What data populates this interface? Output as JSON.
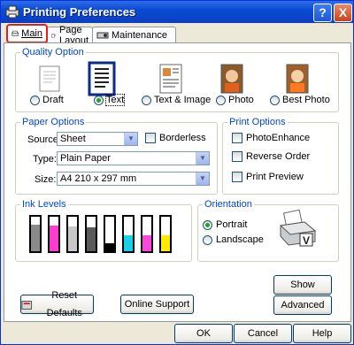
{
  "window": {
    "title": "Printing Preferences",
    "help_btn": "?",
    "close_btn": "X"
  },
  "tabs": [
    {
      "label": "Main",
      "active": true
    },
    {
      "label": "Page Layout",
      "active": false
    },
    {
      "label": "Maintenance",
      "active": false
    }
  ],
  "quality": {
    "legend": "Quality Option",
    "options": [
      {
        "label": "Draft",
        "icon": "draft-icon",
        "selected": false
      },
      {
        "label": "Text",
        "icon": "text-icon",
        "selected": true
      },
      {
        "label": "Text & Image",
        "icon": "text-image-icon",
        "selected": false
      },
      {
        "label": "Photo",
        "icon": "photo-icon",
        "selected": false
      },
      {
        "label": "Best Photo",
        "icon": "best-photo-icon",
        "selected": false
      }
    ]
  },
  "paper": {
    "legend": "Paper Options",
    "source_label": "Source:",
    "source_value": "Sheet",
    "borderless_label": "Borderless",
    "type_label": "Type:",
    "type_value": "Plain Paper",
    "size_label": "Size:",
    "size_value": "A4 210 x 297 mm"
  },
  "print_options": {
    "legend": "Print Options",
    "items": [
      {
        "label": "PhotoEnhance",
        "checked": false
      },
      {
        "label": "Reverse Order",
        "checked": false
      },
      {
        "label": "Print Preview",
        "checked": false
      }
    ]
  },
  "ink": {
    "legend": "Ink Levels",
    "cartridges": [
      {
        "color": "#8a8a8a",
        "level": 0.78
      },
      {
        "color": "#ff3ccf",
        "level": 0.74
      },
      {
        "color": "#c8c8c8",
        "level": 0.72
      },
      {
        "color": "#5a5a5a",
        "level": 0.7
      },
      {
        "color": "#000000",
        "level": 0.22
      },
      {
        "color": "#15d2e6",
        "level": 0.45
      },
      {
        "color": "#ff45e0",
        "level": 0.45
      },
      {
        "color": "#ffea00",
        "level": 0.45
      }
    ]
  },
  "orientation": {
    "legend": "Orientation",
    "portrait_label": "Portrait",
    "landscape_label": "Landscape",
    "selected": "portrait"
  },
  "buttons": {
    "show_settings": "Show Settings",
    "advanced": "Advanced",
    "reset_defaults": "Reset Defaults",
    "online_support": "Online Support",
    "ok": "OK",
    "cancel": "Cancel",
    "help": "Help"
  },
  "colors": {
    "titlebar": "#0a4bd4",
    "group_legend": "#0046d5",
    "active_tab_border": "#e0221a"
  }
}
